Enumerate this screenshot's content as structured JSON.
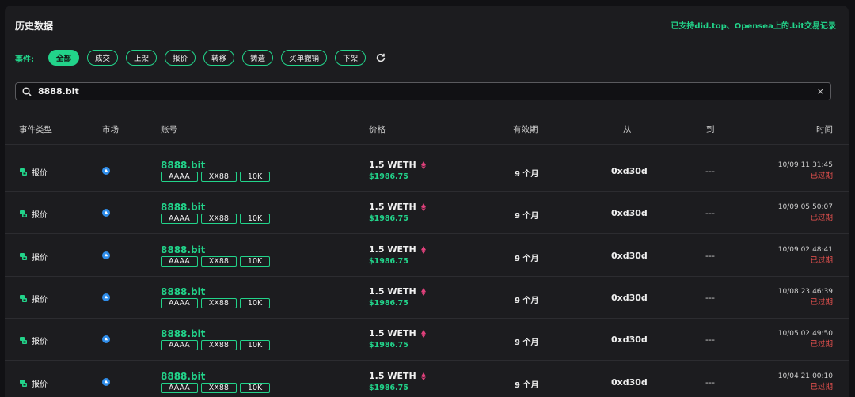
{
  "section_title": "历史数据",
  "support_text": "已支持did.top、Opensea上的.bit交易记录",
  "filters": {
    "label": "事件:",
    "chips": [
      "全部",
      "成交",
      "上架",
      "报价",
      "转移",
      "铸造",
      "买单撤销",
      "下架"
    ],
    "active_index": 0
  },
  "search": {
    "value": "8888.bit",
    "clear": "×"
  },
  "columns": [
    "事件类型",
    "市场",
    "账号",
    "价格",
    "有效期",
    "从",
    "到",
    "时间"
  ],
  "rows": [
    {
      "event": "报价",
      "account": "8888.bit",
      "tags": [
        "AAAA",
        "XX88",
        "10K"
      ],
      "price": "1.5 WETH",
      "usd": "$1986.75",
      "validity": "9 个月",
      "from": "0xd30d",
      "to": "---",
      "time": "10/09 11:31:45",
      "status": "已过期"
    },
    {
      "event": "报价",
      "account": "8888.bit",
      "tags": [
        "AAAA",
        "XX88",
        "10K"
      ],
      "price": "1.5 WETH",
      "usd": "$1986.75",
      "validity": "9 个月",
      "from": "0xd30d",
      "to": "---",
      "time": "10/09 05:50:07",
      "status": "已过期"
    },
    {
      "event": "报价",
      "account": "8888.bit",
      "tags": [
        "AAAA",
        "XX88",
        "10K"
      ],
      "price": "1.5 WETH",
      "usd": "$1986.75",
      "validity": "9 个月",
      "from": "0xd30d",
      "to": "---",
      "time": "10/09 02:48:41",
      "status": "已过期"
    },
    {
      "event": "报价",
      "account": "8888.bit",
      "tags": [
        "AAAA",
        "XX88",
        "10K"
      ],
      "price": "1.5 WETH",
      "usd": "$1986.75",
      "validity": "9 个月",
      "from": "0xd30d",
      "to": "---",
      "time": "10/08 23:46:39",
      "status": "已过期"
    },
    {
      "event": "报价",
      "account": "8888.bit",
      "tags": [
        "AAAA",
        "XX88",
        "10K"
      ],
      "price": "1.5 WETH",
      "usd": "$1986.75",
      "validity": "9 个月",
      "from": "0xd30d",
      "to": "---",
      "time": "10/05 02:49:50",
      "status": "已过期"
    },
    {
      "event": "报价",
      "account": "8888.bit",
      "tags": [
        "AAAA",
        "XX88",
        "10K"
      ],
      "price": "1.5 WETH",
      "usd": "$1986.75",
      "validity": "9 个月",
      "from": "0xd30d",
      "to": "---",
      "time": "10/04 21:00:10",
      "status": "已过期"
    }
  ],
  "colors": {
    "accent": "#22d38a",
    "expired": "#ef5350",
    "eth": "#e0407b",
    "market": "#2f8dea"
  },
  "icons": {
    "event": "offer-icon",
    "market": "opensea-icon",
    "price": "eth-icon",
    "search": "search-icon",
    "refresh": "refresh-icon"
  }
}
